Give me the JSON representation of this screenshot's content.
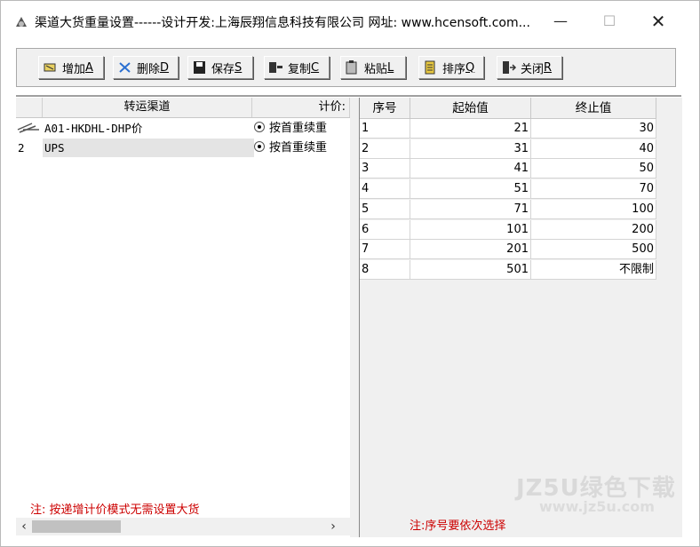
{
  "window": {
    "title": "渠道大货重量设置------设计开发:上海辰翔信息科技有限公司 网址: www.hcensoft.com...",
    "minimize": "—",
    "maximize": "☐",
    "close": "✕"
  },
  "toolbar": {
    "add": {
      "label": "增加",
      "key": "A"
    },
    "delete": {
      "label": "删除",
      "key": "D"
    },
    "save": {
      "label": "保存",
      "key": "S"
    },
    "copy": {
      "label": "复制",
      "key": "C"
    },
    "paste": {
      "label": "粘贴",
      "key": "L"
    },
    "sort": {
      "label": "排序",
      "key": "Q"
    },
    "close": {
      "label": "关闭",
      "key": "R"
    }
  },
  "left_grid": {
    "headers": [
      "转运渠道",
      "计价:"
    ],
    "rows": [
      {
        "index": "",
        "channel": "A01-HKDHL-DHP价",
        "pricing": "按首重续重"
      },
      {
        "index": "2",
        "channel": "UPS",
        "pricing": "按首重续重"
      }
    ],
    "note": "注: 按递增计价模式无需设置大货"
  },
  "right_grid": {
    "headers": [
      "序号",
      "起始值",
      "终止值"
    ],
    "rows": [
      {
        "no": "1",
        "start": "21",
        "end": "30"
      },
      {
        "no": "2",
        "start": "31",
        "end": "40"
      },
      {
        "no": "3",
        "start": "41",
        "end": "50"
      },
      {
        "no": "4",
        "start": "51",
        "end": "70"
      },
      {
        "no": "5",
        "start": "71",
        "end": "100"
      },
      {
        "no": "6",
        "start": "101",
        "end": "200"
      },
      {
        "no": "7",
        "start": "201",
        "end": "500"
      },
      {
        "no": "8",
        "start": "501",
        "end": "不限制"
      }
    ],
    "note": "注:序号要依次选择"
  },
  "watermark": {
    "line1": "JZ5U绿色下载",
    "line2": "www.jz5u.com"
  }
}
